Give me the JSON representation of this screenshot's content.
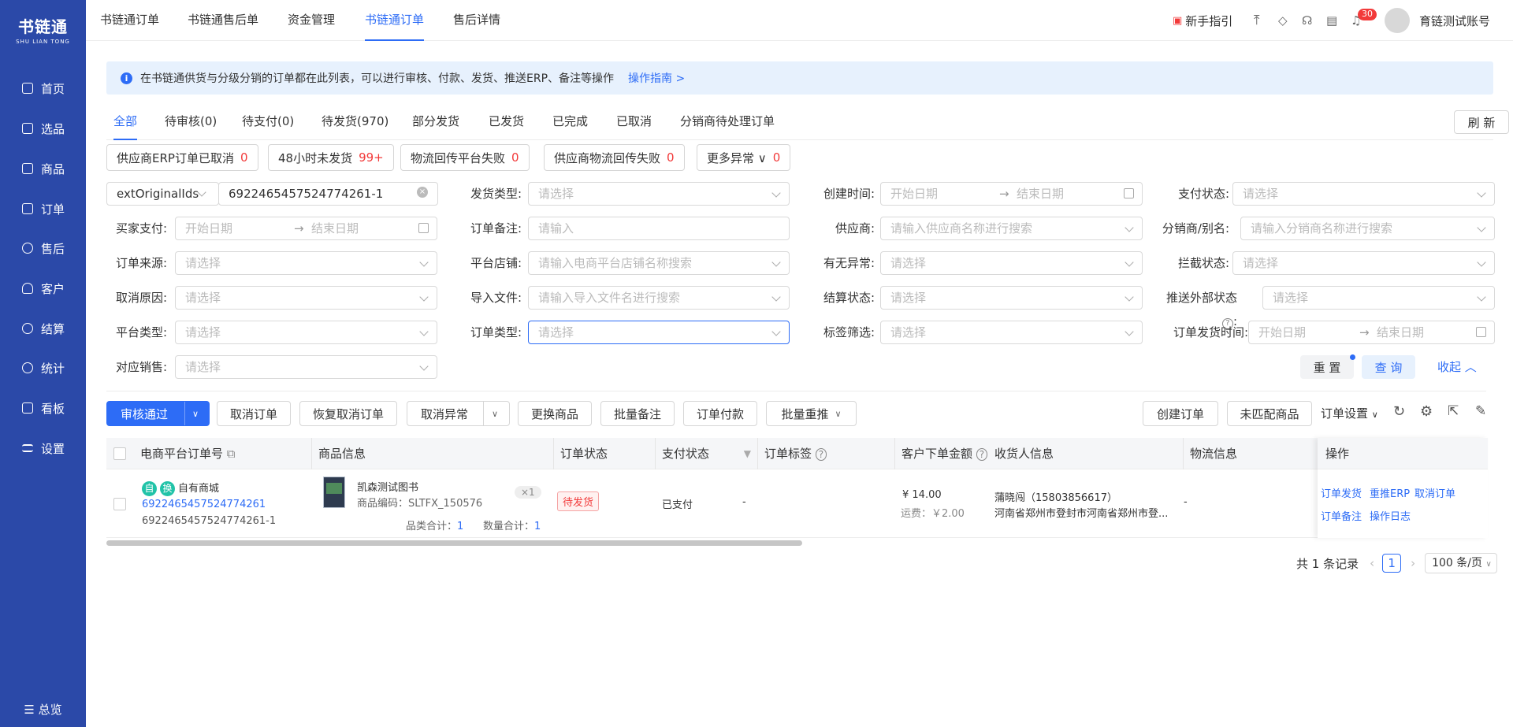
{
  "logo": {
    "cn": "书链通",
    "en": "SHU LIAN TONG"
  },
  "sidebar": {
    "items": [
      {
        "label": "首页",
        "icon": "monitor-icon"
      },
      {
        "label": "选品",
        "icon": "checklist-icon"
      },
      {
        "label": "商品",
        "icon": "box-icon"
      },
      {
        "label": "订单",
        "icon": "order-icon"
      },
      {
        "label": "售后",
        "icon": "service-icon"
      },
      {
        "label": "客户",
        "icon": "user-icon"
      },
      {
        "label": "结算",
        "icon": "settle-icon"
      },
      {
        "label": "统计",
        "icon": "chart-icon"
      },
      {
        "label": "看板",
        "icon": "board-icon"
      },
      {
        "label": "设置",
        "icon": "settings-icon"
      }
    ],
    "bottom": "总览"
  },
  "topnav": {
    "items": [
      "书链通订单",
      "书链通售后单",
      "资金管理",
      "书链通订单",
      "售后详情"
    ],
    "active_index": 3,
    "guide": "新手指引",
    "notify_count": "30",
    "account": "育链测试账号"
  },
  "notice": {
    "text": "在书链通供货与分级分销的订单都在此列表，可以进行审核、付款、发货、推送ERP、备注等操作",
    "link": "操作指南 >"
  },
  "tabs": {
    "items": [
      "全部",
      "待审核(0)",
      "待支付(0)",
      "待发货(970)",
      "部分发货",
      "已发货",
      "已完成",
      "已取消",
      "分销商待处理订单"
    ],
    "refresh": "刷 新"
  },
  "chips": [
    {
      "label": "供应商ERP订单已取消",
      "count": "0"
    },
    {
      "label": "48小时未发货",
      "count": "99+"
    },
    {
      "label": "物流回传平台失败",
      "count": "0"
    },
    {
      "label": "供应商物流回传失败",
      "count": "0"
    },
    {
      "label": "更多异常 ∨",
      "count": "0"
    }
  ],
  "filters": {
    "search_key": "extOriginalIds",
    "search_value": "6922465457524774261-1",
    "start_date": "开始日期",
    "end_date": "结束日期",
    "select_ph": "请选择",
    "input_ph": "请输入",
    "supplier_ph": "请输入供应商名称进行搜索",
    "distributor_ph": "请输入分销商名称进行搜索",
    "shop_ph": "请输入电商平台店铺名称搜索",
    "file_ph": "请输入导入文件名进行搜索",
    "labels": {
      "ship_type": "发货类型:",
      "create_time": "创建时间:",
      "pay_status": "支付状态:",
      "buyer_pay": "买家支付:",
      "order_remark": "订单备注:",
      "supplier": "供应商:",
      "distributor": "分销商/别名:",
      "order_source": "订单来源:",
      "platform_shop": "平台店铺:",
      "has_exception": "有无异常:",
      "intercept_status": "拦截状态:",
      "cancel_reason": "取消原因:",
      "import_file": "导入文件:",
      "settle_status": "结算状态:",
      "push_status": "推送外部状态",
      "platform_type": "平台类型:",
      "order_type": "订单类型:",
      "tag_filter": "标签筛选:",
      "ship_time": "订单发货时间:",
      "sales": "对应销售:"
    },
    "reset": "重 置",
    "query": "查 询",
    "collapse": "收起"
  },
  "toolbar": {
    "approve": "审核通过",
    "cancel": "取消订单",
    "restore": "恢复取消订单",
    "cancel_exc": "取消异常",
    "replace": "更换商品",
    "batch_remark": "批量备注",
    "pay": "订单付款",
    "batch_push": "批量重推",
    "create": "创建订单",
    "unmatched": "未匹配商品",
    "settings": "订单设置"
  },
  "table": {
    "headers": [
      "电商平台订单号",
      "商品信息",
      "订单状态",
      "支付状态",
      "订单标签",
      "客户下单金额",
      "收货人信息",
      "物流信息",
      "操作"
    ],
    "rows": [
      {
        "tag1": "自",
        "tag2": "换",
        "shop": "自有商城",
        "order_no": "6922465457524774261",
        "ext_no": "6922465457524774261-1",
        "product": "凯森测试图书",
        "sku": "商品编码：SLTFX_150576",
        "qty": "×1",
        "kinds_label": "品类合计：",
        "kinds": "1",
        "count_label": "数量合计：",
        "count": "1",
        "status": "待发货",
        "pay": "已支付",
        "label": "-",
        "amount": "¥ 14.00",
        "freight": "运费：￥2.00",
        "receiver": "蒲晓闯（15803856617）",
        "address": "河南省郑州市登封市河南省郑州市登...",
        "logistics": "-",
        "ops": [
          "订单发货",
          "重推ERP",
          "取消订单",
          "订单备注",
          "操作日志"
        ]
      }
    ]
  },
  "pagination": {
    "total": "共 1 条记录",
    "page": "1",
    "size": "100 条/页"
  },
  "colors": {
    "sidebar": "#2b49a8",
    "accent": "#2d6cf6",
    "danger": "#f23a3a",
    "tag": "#21c3a8"
  }
}
